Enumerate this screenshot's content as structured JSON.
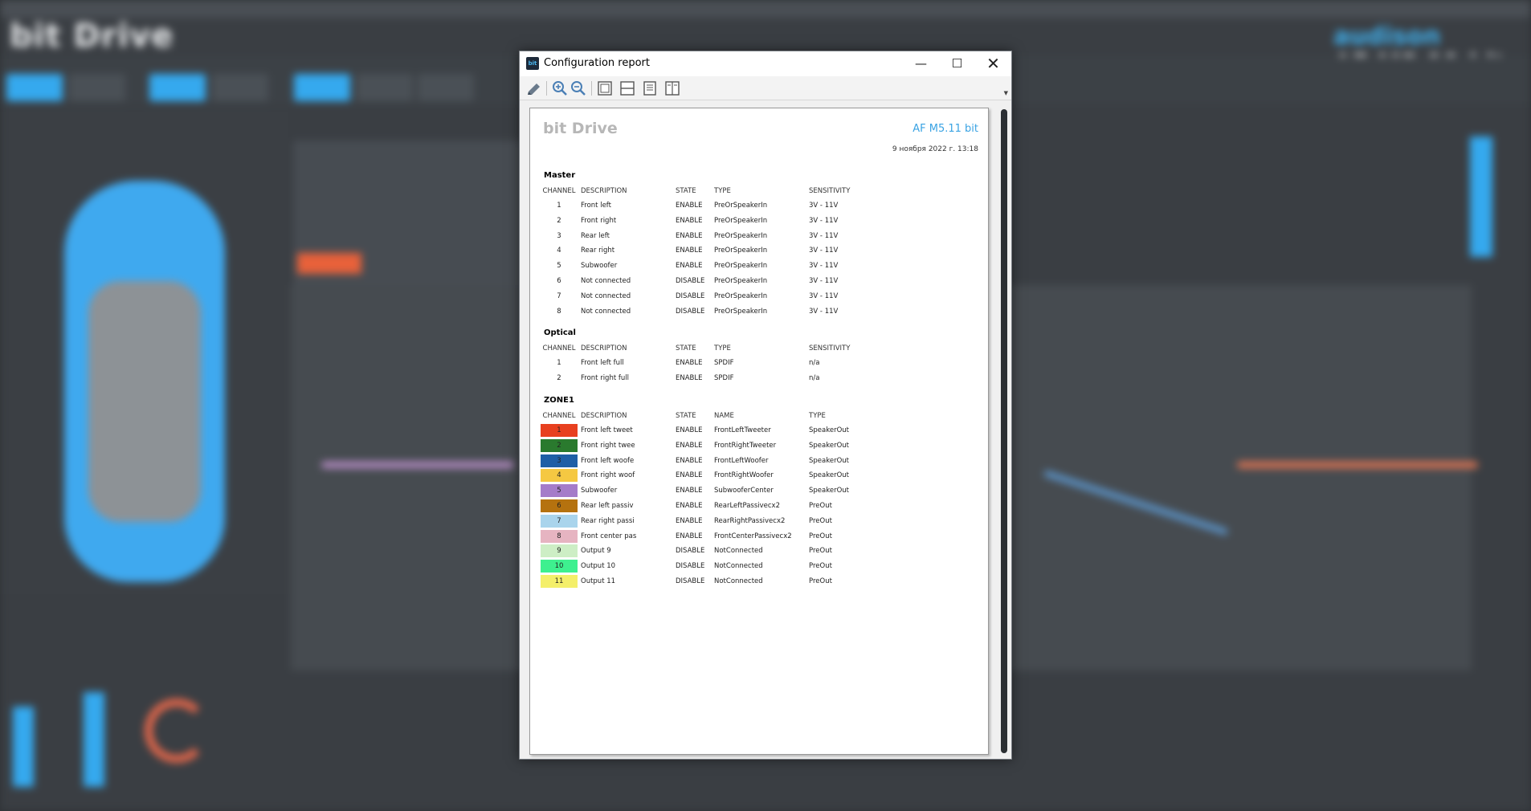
{
  "background": {
    "logo": "bit Drive",
    "brand": "audison",
    "model": "AF M5.11 bit"
  },
  "dialog": {
    "title": "Configuration report",
    "icon_label": "bit",
    "controls": {
      "minimize": "—",
      "maximize": "☐",
      "close": "✕"
    }
  },
  "toolbar": {
    "icons": [
      "print-icon",
      "zoom-in-icon",
      "zoom-out-icon",
      "fit-page-icon",
      "page-width-icon",
      "single-page-icon",
      "two-pages-icon"
    ]
  },
  "report": {
    "logo": "bit Drive",
    "device": "AF M5.11 bit",
    "date": "9 ноября 2022 г. 13:18",
    "master": {
      "title": "Master",
      "headers": {
        "channel": "CHANNEL",
        "description": "DESCRIPTION",
        "state": "STATE",
        "type": "TYPE",
        "sensitivity": "SENSITIVITY"
      },
      "rows": [
        {
          "channel": "1",
          "description": "Front left",
          "state": "ENABLE",
          "type": "PreOrSpeakerIn",
          "sensitivity": "3V - 11V"
        },
        {
          "channel": "2",
          "description": "Front right",
          "state": "ENABLE",
          "type": "PreOrSpeakerIn",
          "sensitivity": "3V - 11V"
        },
        {
          "channel": "3",
          "description": "Rear left",
          "state": "ENABLE",
          "type": "PreOrSpeakerIn",
          "sensitivity": "3V - 11V"
        },
        {
          "channel": "4",
          "description": "Rear right",
          "state": "ENABLE",
          "type": "PreOrSpeakerIn",
          "sensitivity": "3V - 11V"
        },
        {
          "channel": "5",
          "description": "Subwoofer",
          "state": "ENABLE",
          "type": "PreOrSpeakerIn",
          "sensitivity": "3V - 11V"
        },
        {
          "channel": "6",
          "description": "Not connected",
          "state": "DISABLE",
          "type": "PreOrSpeakerIn",
          "sensitivity": "3V - 11V"
        },
        {
          "channel": "7",
          "description": "Not connected",
          "state": "DISABLE",
          "type": "PreOrSpeakerIn",
          "sensitivity": "3V - 11V"
        },
        {
          "channel": "8",
          "description": "Not connected",
          "state": "DISABLE",
          "type": "PreOrSpeakerIn",
          "sensitivity": "3V - 11V"
        }
      ]
    },
    "optical": {
      "title": "Optical",
      "headers": {
        "channel": "CHANNEL",
        "description": "DESCRIPTION",
        "state": "STATE",
        "type": "TYPE",
        "sensitivity": "SENSITIVITY"
      },
      "rows": [
        {
          "channel": "1",
          "description": "Front left full",
          "state": "ENABLE",
          "type": "SPDIF",
          "sensitivity": "n/a"
        },
        {
          "channel": "2",
          "description": "Front right full",
          "state": "ENABLE",
          "type": "SPDIF",
          "sensitivity": "n/a"
        }
      ]
    },
    "zone1": {
      "title": "ZONE1",
      "headers": {
        "channel": "CHANNEL",
        "description": "DESCRIPTION",
        "state": "STATE",
        "name": "NAME",
        "type": "TYPE"
      },
      "rows": [
        {
          "channel": "1",
          "description": "Front left tweet",
          "state": "ENABLE",
          "name": "FrontLeftTweeter",
          "type": "SpeakerOut",
          "color": "#e8401f"
        },
        {
          "channel": "2",
          "description": "Front right twee",
          "state": "ENABLE",
          "name": "FrontRightTweeter",
          "type": "SpeakerOut",
          "color": "#2a7a2e"
        },
        {
          "channel": "3",
          "description": "Front left woofe",
          "state": "ENABLE",
          "name": "FrontLeftWoofer",
          "type": "SpeakerOut",
          "color": "#1f5fa6"
        },
        {
          "channel": "4",
          "description": "Front right woof",
          "state": "ENABLE",
          "name": "FrontRightWoofer",
          "type": "SpeakerOut",
          "color": "#f5c842"
        },
        {
          "channel": "5",
          "description": "Subwoofer",
          "state": "ENABLE",
          "name": "SubwooferCenter",
          "type": "SpeakerOut",
          "color": "#a57cc9"
        },
        {
          "channel": "6",
          "description": "Rear left passiv",
          "state": "ENABLE",
          "name": "RearLeftPassivecx2",
          "type": "PreOut",
          "color": "#b5720f"
        },
        {
          "channel": "7",
          "description": "Rear right passi",
          "state": "ENABLE",
          "name": "RearRightPassivecx2",
          "type": "PreOut",
          "color": "#a9d4ec"
        },
        {
          "channel": "8",
          "description": "Front center pas",
          "state": "ENABLE",
          "name": "FrontCenterPassivecx2",
          "type": "PreOut",
          "color": "#e6b4c1"
        },
        {
          "channel": "9",
          "description": "Output 9",
          "state": "DISABLE",
          "name": "NotConnected",
          "type": "PreOut",
          "color": "#cdeec5"
        },
        {
          "channel": "10",
          "description": "Output 10",
          "state": "DISABLE",
          "name": "NotConnected",
          "type": "PreOut",
          "color": "#3ef08f"
        },
        {
          "channel": "11",
          "description": "Output 11",
          "state": "DISABLE",
          "name": "NotConnected",
          "type": "PreOut",
          "color": "#f4ef6a"
        }
      ]
    }
  }
}
